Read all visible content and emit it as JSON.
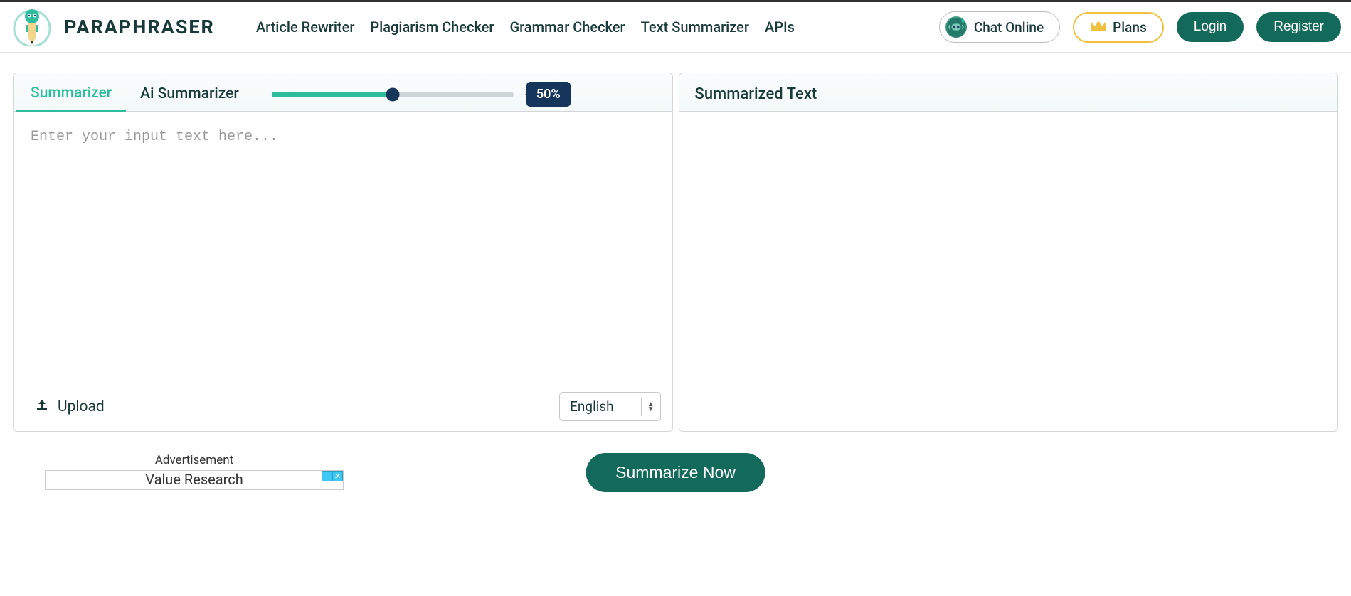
{
  "brand": "PARAPHRASER",
  "nav": {
    "article_rewriter": "Article Rewriter",
    "plagiarism_checker": "Plagiarism Checker",
    "grammar_checker": "Grammar Checker",
    "text_summarizer": "Text Summarizer",
    "apis": "APIs"
  },
  "chat_label": "Chat Online",
  "plans_label": "Plans",
  "login_label": "Login",
  "register_label": "Register",
  "tabs": {
    "summarizer": "Summarizer",
    "ai_summarizer": "Ai Summarizer"
  },
  "slider_percent": "50%",
  "input_placeholder": "Enter your input text here...",
  "upload_label": "Upload",
  "language_selected": "English",
  "output_title": "Summarized Text",
  "advertisement_label": "Advertisement",
  "ad_text": "Value Research",
  "summarize_button": "Summarize Now"
}
